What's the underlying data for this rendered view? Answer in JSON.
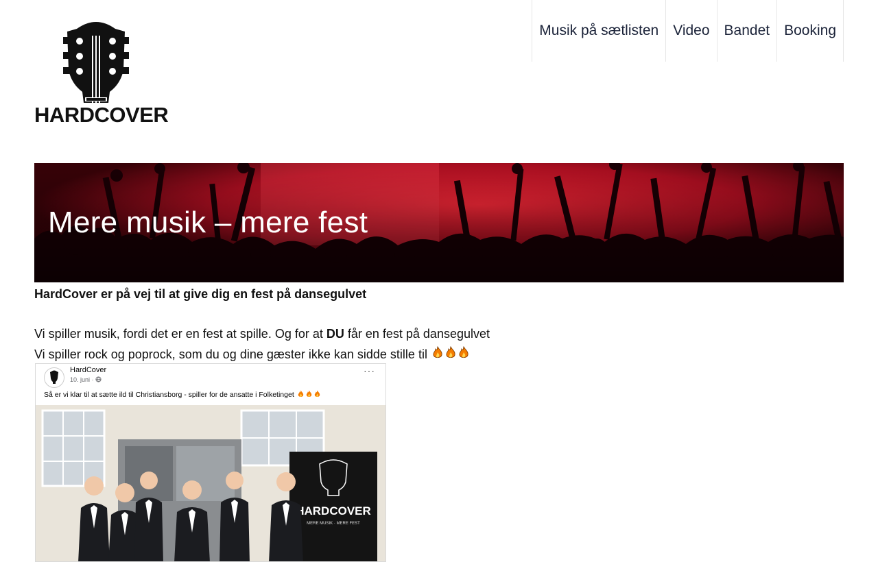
{
  "site": {
    "logo_text": "HARDCOVER",
    "nav": [
      {
        "label": "Musik på sætlisten"
      },
      {
        "label": "Video"
      },
      {
        "label": "Bandet"
      },
      {
        "label": "Booking"
      }
    ]
  },
  "hero": {
    "title": "Mere musik – mere fest"
  },
  "content": {
    "lead": "HardCover er på vej til at give dig en fest på dansegulvet",
    "line1_before": "Vi spiller musik, fordi det er en fest at spille. Og for at ",
    "line1_bold": "DU",
    "line1_after": " får en fest på dansegulvet",
    "line2": "Vi spiller rock og poprock, som du og dine gæster ikke kan sidde stille til"
  },
  "post": {
    "author": "HardCover",
    "date": "10. juni ·",
    "menu": "···",
    "text": "Så er vi klar til at sætte ild til Christiansborg - spiller for de ansatte i Folketinget",
    "banner_text": "HARDCOVER",
    "banner_subtext": "MERE MUSIK · MERE FEST"
  },
  "colors": {
    "nav_text": "#1a2238",
    "hero_red": "#d0122a",
    "text": "#111111"
  }
}
